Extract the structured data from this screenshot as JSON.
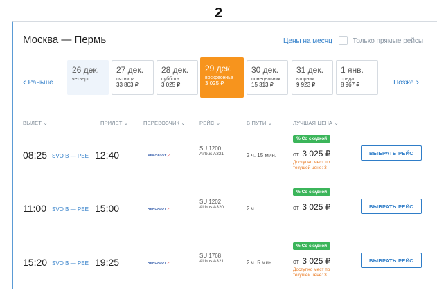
{
  "page_number": "2",
  "header": {
    "route_title": "Москва — Пермь",
    "price_month_link": "Цены на месяц",
    "direct_only_label": "Только прямые рейсы"
  },
  "date_nav": {
    "earlier": "Раньше",
    "later": "Позже",
    "dates": [
      {
        "date": "26 дек.",
        "day": "четверг",
        "price": ""
      },
      {
        "date": "27 дек.",
        "day": "пятница",
        "price": "33 803 ₽"
      },
      {
        "date": "28 дек.",
        "day": "суббота",
        "price": "3 025 ₽"
      },
      {
        "date": "29 дек.",
        "day": "воскресенье",
        "price": "3 025 ₽"
      },
      {
        "date": "30 дек.",
        "day": "понедельник",
        "price": "15 313 ₽"
      },
      {
        "date": "31 дек.",
        "day": "вторник",
        "price": "9 923 ₽"
      },
      {
        "date": "1 янв.",
        "day": "среда",
        "price": "8 967 ₽"
      }
    ]
  },
  "columns": {
    "departure": "ВЫЛЕТ",
    "arrival": "ПРИЛЕТ",
    "carrier": "ПЕРЕВОЗЧИК",
    "flight": "РЕЙС",
    "duration": "В ПУТИ",
    "best_price": "ЛУЧШАЯ ЦЕНА",
    "sort_arrow": "⌄"
  },
  "airline_logo_text": "AEROFLOT",
  "flights": [
    {
      "dep": "08:25",
      "route": "SVO B — PEE",
      "arr": "12:40",
      "flight_no": "SU 1200",
      "aircraft": "Airbus A321",
      "duration": "2 ч. 15 мин.",
      "badge": "% Со скидкой",
      "price_from": "от",
      "price": "3 025 ₽",
      "seats": "Доступно мест по текущей цене: 3",
      "button": "ВЫБРАТЬ РЕЙС"
    },
    {
      "dep": "11:00",
      "route": "SVO B — PEE",
      "arr": "15:00",
      "flight_no": "SU 1202",
      "aircraft": "Airbus A320",
      "duration": "2 ч.",
      "badge": "% Со скидкой",
      "price_from": "от",
      "price": "3 025 ₽",
      "seats": "",
      "button": "ВЫБРАТЬ РЕЙС"
    },
    {
      "dep": "15:20",
      "route": "SVO B — PEE",
      "arr": "19:25",
      "flight_no": "SU 1768",
      "aircraft": "Airbus A321",
      "duration": "2 ч. 5 мин.",
      "badge": "% Со скидкой",
      "price_from": "от",
      "price": "3 025 ₽",
      "seats": "Доступно мест по текущей цене: 3",
      "button": "ВЫБРАТЬ РЕЙС"
    }
  ]
}
